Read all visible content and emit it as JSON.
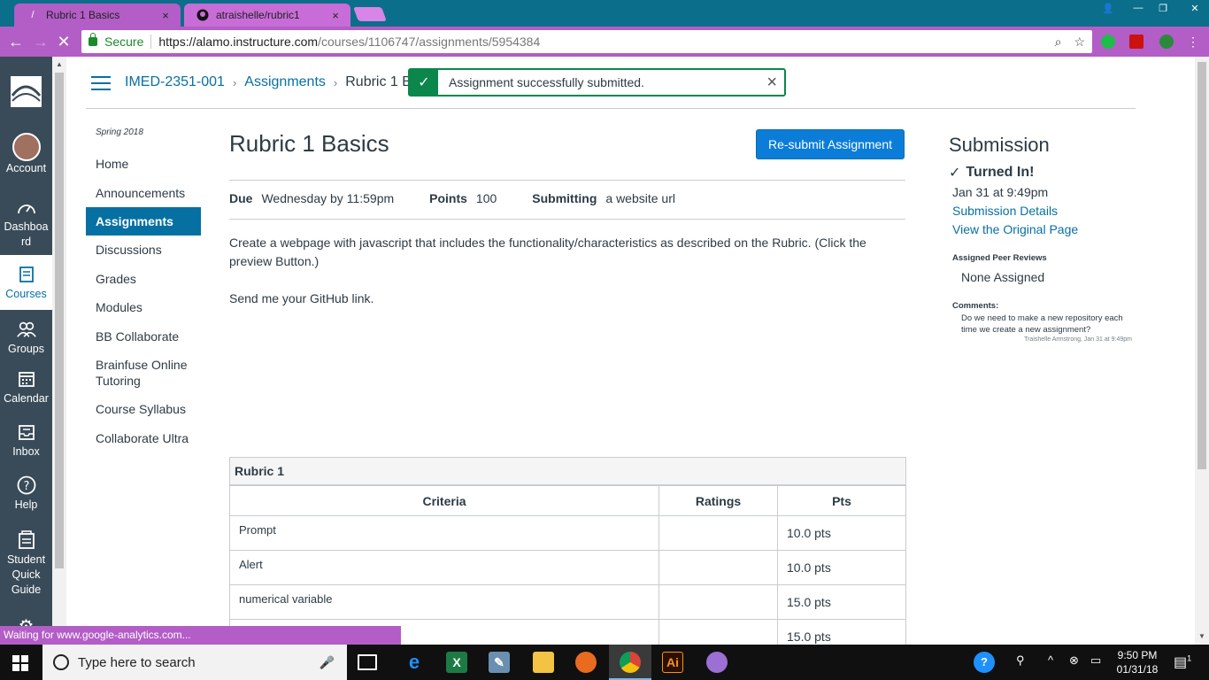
{
  "browser": {
    "tabs": [
      {
        "label": "Rubric 1 Basics",
        "close": "×"
      },
      {
        "label": "atraishelle/rubric1",
        "close": "×"
      }
    ],
    "secure_label": "Secure",
    "url_host": "https://alamo.instructure.com",
    "url_path": "/courses/1106747/assignments/5954384",
    "status_text": "Waiting for www.google-analytics.com..."
  },
  "global_nav": {
    "items": [
      {
        "label": "Account",
        "icon": "avatar"
      },
      {
        "label": "Dashboa rd",
        "icon": "dashboard-icon"
      },
      {
        "label": "Courses",
        "icon": "courses-icon"
      },
      {
        "label": "Groups",
        "icon": "groups-icon"
      },
      {
        "label": "Calendar",
        "icon": "calendar-icon"
      },
      {
        "label": "Inbox",
        "icon": "inbox-icon"
      },
      {
        "label": "Help",
        "icon": "help-icon"
      },
      {
        "label": "Student Quick Guide",
        "icon": "guide-icon"
      }
    ]
  },
  "breadcrumb": {
    "course": "IMED-2351-001",
    "section": "Assignments",
    "current": "Rubric 1 Basics"
  },
  "flash": {
    "message": "Assignment successfully submitted."
  },
  "course_nav": {
    "term": "Spring 2018",
    "items": [
      "Home",
      "Announcements",
      "Assignments",
      "Discussions",
      "Grades",
      "Modules",
      "BB Collaborate",
      "Brainfuse Online Tutoring",
      "Course Syllabus",
      "Collaborate Ultra"
    ],
    "active": "Assignments"
  },
  "assignment": {
    "title": "Rubric 1 Basics",
    "resubmit_label": "Re-submit Assignment",
    "due_label": "Due",
    "due_value": "Wednesday by 11:59pm",
    "points_label": "Points",
    "points_value": "100",
    "submitting_label": "Submitting",
    "submitting_value": "a website url",
    "description": [
      "Create a webpage with javascript that includes the functionality/characteristics as described on the Rubric. (Click the preview Button.)",
      "Send me your GitHub link."
    ]
  },
  "rubric": {
    "title": "Rubric 1",
    "headers": [
      "Criteria",
      "Ratings",
      "Pts"
    ],
    "rows": [
      {
        "criteria": "Prompt",
        "ratings": "",
        "pts": "10.0 pts"
      },
      {
        "criteria": "Alert",
        "ratings": "",
        "pts": "10.0 pts"
      },
      {
        "criteria": "numerical variable",
        "ratings": "",
        "pts": "15.0 pts"
      },
      {
        "criteria": "",
        "ratings": "",
        "pts": "15.0 pts"
      }
    ]
  },
  "submission": {
    "title": "Submission",
    "status": "Turned In!",
    "date": "Jan 31 at 9:49pm",
    "details_link": "Submission Details",
    "original_link": "View the Original Page",
    "peer_reviews_label": "Assigned Peer Reviews",
    "peer_reviews_value": "None Assigned",
    "comments_label": "Comments:",
    "comment_text": "Do we need to make a new repository each time we create a new assignment?",
    "comment_meta": "Traishelle Armstrong, Jan 31 at 9:49pm"
  },
  "taskbar": {
    "search_placeholder": "Type here to search",
    "time": "9:50 PM",
    "date": "01/31/18",
    "notifications": "1"
  },
  "colors": {
    "canvas_nav": "#394b58",
    "link": "#0770a3",
    "button": "#0b7dd9",
    "success": "#0b874b",
    "chrome_theme": "#b35dc6"
  }
}
